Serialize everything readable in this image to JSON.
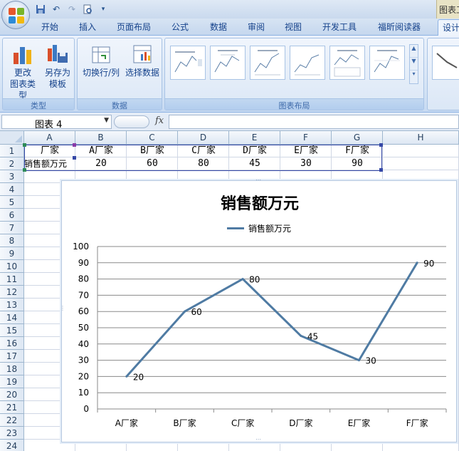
{
  "app": {
    "context_title": "图表工",
    "qat": [
      "save-icon",
      "undo-icon",
      "redo-icon",
      "print-preview-icon",
      "customize-icon"
    ]
  },
  "tabs": [
    "开始",
    "插入",
    "页面布局",
    "公式",
    "数据",
    "审阅",
    "视图",
    "开发工具",
    "福昕阅读器",
    "设计"
  ],
  "active_tab": "设计",
  "ribbon": {
    "groups": [
      {
        "label": "类型",
        "buttons": [
          {
            "line1": "更改",
            "line2": "图表类型"
          },
          {
            "line1": "另存为",
            "line2": "模板"
          }
        ]
      },
      {
        "label": "数据",
        "buttons": [
          {
            "line1": "切换行/列",
            "line2": ""
          },
          {
            "line1": "选择数据",
            "line2": ""
          }
        ]
      },
      {
        "label": "图表布局"
      }
    ]
  },
  "formula_bar": {
    "name_box": "图表 4",
    "fx": "fx",
    "formula": ""
  },
  "sheet": {
    "columns": [
      "A",
      "B",
      "C",
      "D",
      "E",
      "F",
      "G",
      "H"
    ],
    "rows": [
      "1",
      "2",
      "3",
      "4",
      "5",
      "6",
      "7",
      "8",
      "9",
      "10",
      "11",
      "12",
      "13",
      "14",
      "15",
      "16",
      "17",
      "18",
      "19",
      "20",
      "21",
      "22",
      "23",
      "24"
    ],
    "row1": [
      "厂家",
      "A厂家",
      "B厂家",
      "C厂家",
      "D厂家",
      "E厂家",
      "F厂家"
    ],
    "row2": [
      "销售额万元",
      "20",
      "60",
      "80",
      "45",
      "30",
      "90"
    ]
  },
  "chart_data": {
    "type": "line",
    "title": "销售额万元",
    "categories": [
      "A厂家",
      "B厂家",
      "C厂家",
      "D厂家",
      "E厂家",
      "F厂家"
    ],
    "series": [
      {
        "name": "销售额万元",
        "values": [
          20,
          60,
          80,
          45,
          30,
          90
        ],
        "color": "#4f7ba3"
      }
    ],
    "ylim": [
      0,
      100
    ],
    "yticks": [
      0,
      10,
      20,
      30,
      40,
      50,
      60,
      70,
      80,
      90,
      100
    ],
    "grid": true,
    "legend": "top",
    "data_labels": true
  }
}
